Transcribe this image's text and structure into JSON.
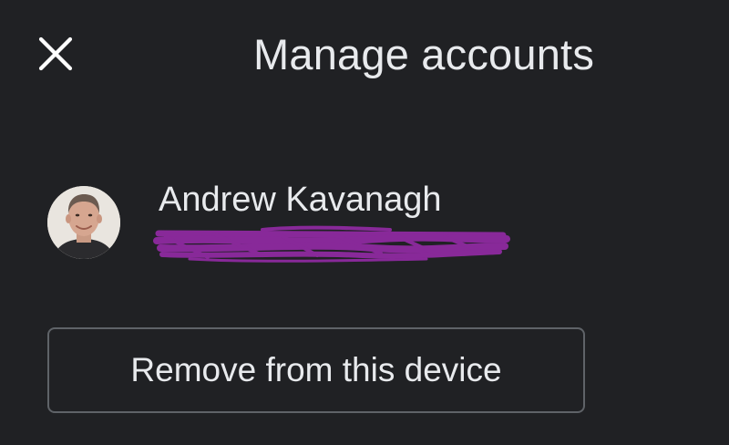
{
  "header": {
    "title": "Manage accounts",
    "close_icon": "close-icon"
  },
  "account": {
    "name": "Andrew Kavanagh",
    "email_redacted": true,
    "redaction_color": "#8b2a9c",
    "avatar_icon": "avatar-photo"
  },
  "actions": {
    "remove_label": "Remove from this device"
  },
  "colors": {
    "background": "#202124",
    "text": "#e8eaed",
    "button_border": "#5f6368"
  }
}
